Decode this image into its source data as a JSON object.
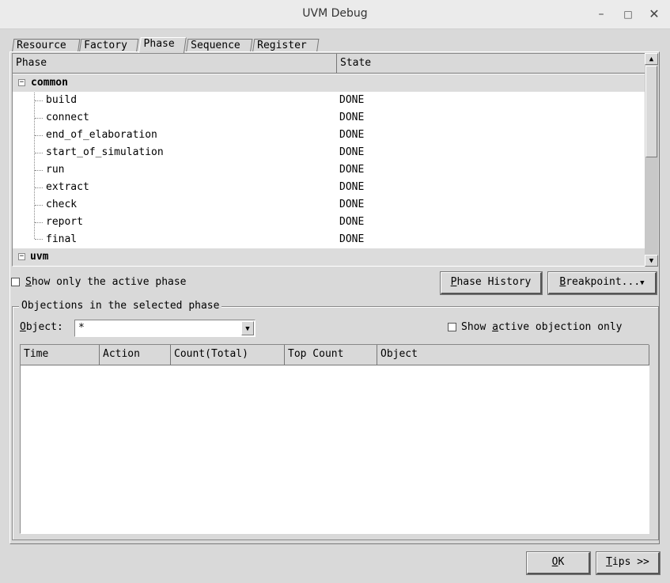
{
  "window": {
    "title": "UVM Debug",
    "min": "–",
    "max": "□",
    "close": "✕"
  },
  "tabs": [
    {
      "label": "Resource"
    },
    {
      "label": "Factory"
    },
    {
      "label": "Phase"
    },
    {
      "label": "Sequence"
    },
    {
      "label": "Register"
    }
  ],
  "active_tab": "Phase",
  "phase_tree": {
    "columns": [
      "Phase",
      "State"
    ],
    "groups": [
      {
        "name": "common",
        "expander": "−",
        "children": [
          {
            "name": "build",
            "state": "DONE"
          },
          {
            "name": "connect",
            "state": "DONE"
          },
          {
            "name": "end_of_elaboration",
            "state": "DONE"
          },
          {
            "name": "start_of_simulation",
            "state": "DONE"
          },
          {
            "name": "run",
            "state": "DONE"
          },
          {
            "name": "extract",
            "state": "DONE"
          },
          {
            "name": "check",
            "state": "DONE"
          },
          {
            "name": "report",
            "state": "DONE"
          },
          {
            "name": "final",
            "state": "DONE"
          }
        ]
      },
      {
        "name": "uvm",
        "expander": "−",
        "children": []
      }
    ],
    "scroll_up": "▲",
    "scroll_down": "▼"
  },
  "controls": {
    "show_active_phase": {
      "label_u": "S",
      "label_rest": "how only the active phase",
      "checked": false
    },
    "phase_history": {
      "label_u": "P",
      "label_rest": "hase History"
    },
    "breakpoint": {
      "label_u": "B",
      "label_rest": "reakpoint...",
      "arrow": "▼"
    }
  },
  "objections": {
    "title": "Objections in the selected phase",
    "object_label_u": "O",
    "object_label_rest": "bject:",
    "object_value": "*",
    "object_dropdown": "▼",
    "show_active_pre": "Show ",
    "show_active_u": "a",
    "show_active_rest": "ctive objection only",
    "show_active_checked": false,
    "columns": [
      "Time",
      "Action",
      "Count(Total)",
      "Top Count",
      "Object"
    ],
    "rows": []
  },
  "footer": {
    "ok_u": "O",
    "ok_rest": "K",
    "tips_u": "T",
    "tips_rest": "ips >>"
  }
}
